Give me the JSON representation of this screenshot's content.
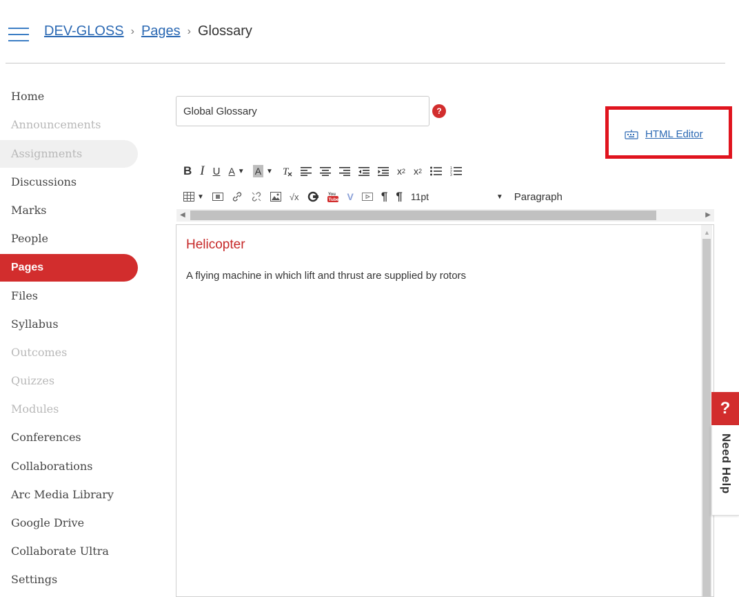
{
  "breadcrumb": {
    "course": "DEV-GLOSS",
    "section": "Pages",
    "current": "Glossary",
    "separator": "›"
  },
  "sidebar": {
    "items": [
      {
        "label": "Home",
        "state": "normal"
      },
      {
        "label": "Announcements",
        "state": "disabled"
      },
      {
        "label": "Assignments",
        "state": "disabled-highlighted"
      },
      {
        "label": "Discussions",
        "state": "normal"
      },
      {
        "label": "Marks",
        "state": "normal"
      },
      {
        "label": "People",
        "state": "normal"
      },
      {
        "label": "Pages",
        "state": "active"
      },
      {
        "label": "Files",
        "state": "normal"
      },
      {
        "label": "Syllabus",
        "state": "normal"
      },
      {
        "label": "Outcomes",
        "state": "disabled"
      },
      {
        "label": "Quizzes",
        "state": "disabled"
      },
      {
        "label": "Modules",
        "state": "disabled"
      },
      {
        "label": "Conferences",
        "state": "normal"
      },
      {
        "label": "Collaborations",
        "state": "normal"
      },
      {
        "label": "Arc Media Library",
        "state": "normal"
      },
      {
        "label": "Google Drive",
        "state": "normal"
      },
      {
        "label": "Collaborate Ultra",
        "state": "normal"
      },
      {
        "label": "Settings",
        "state": "normal"
      }
    ]
  },
  "title_field": {
    "value": "Global Glossary",
    "required_badge": "?"
  },
  "html_editor": {
    "label": "HTML Editor",
    "icon": "keyboard-icon"
  },
  "toolbar": {
    "font_size": "11pt",
    "paragraph": "Paragraph",
    "bold": "B",
    "italic": "I",
    "underline": "U",
    "text_color": "A",
    "bg_color": "A",
    "superscript": "x",
    "subscript": "x"
  },
  "editor": {
    "heading": "Helicopter",
    "body": "A flying machine in which lift and thrust are supplied by rotors"
  },
  "help": {
    "icon": "?",
    "label": "Need Help"
  },
  "colors": {
    "brand_red": "#d22d2d",
    "link_blue": "#2a68b3",
    "highlight_box": "#e0141e"
  }
}
